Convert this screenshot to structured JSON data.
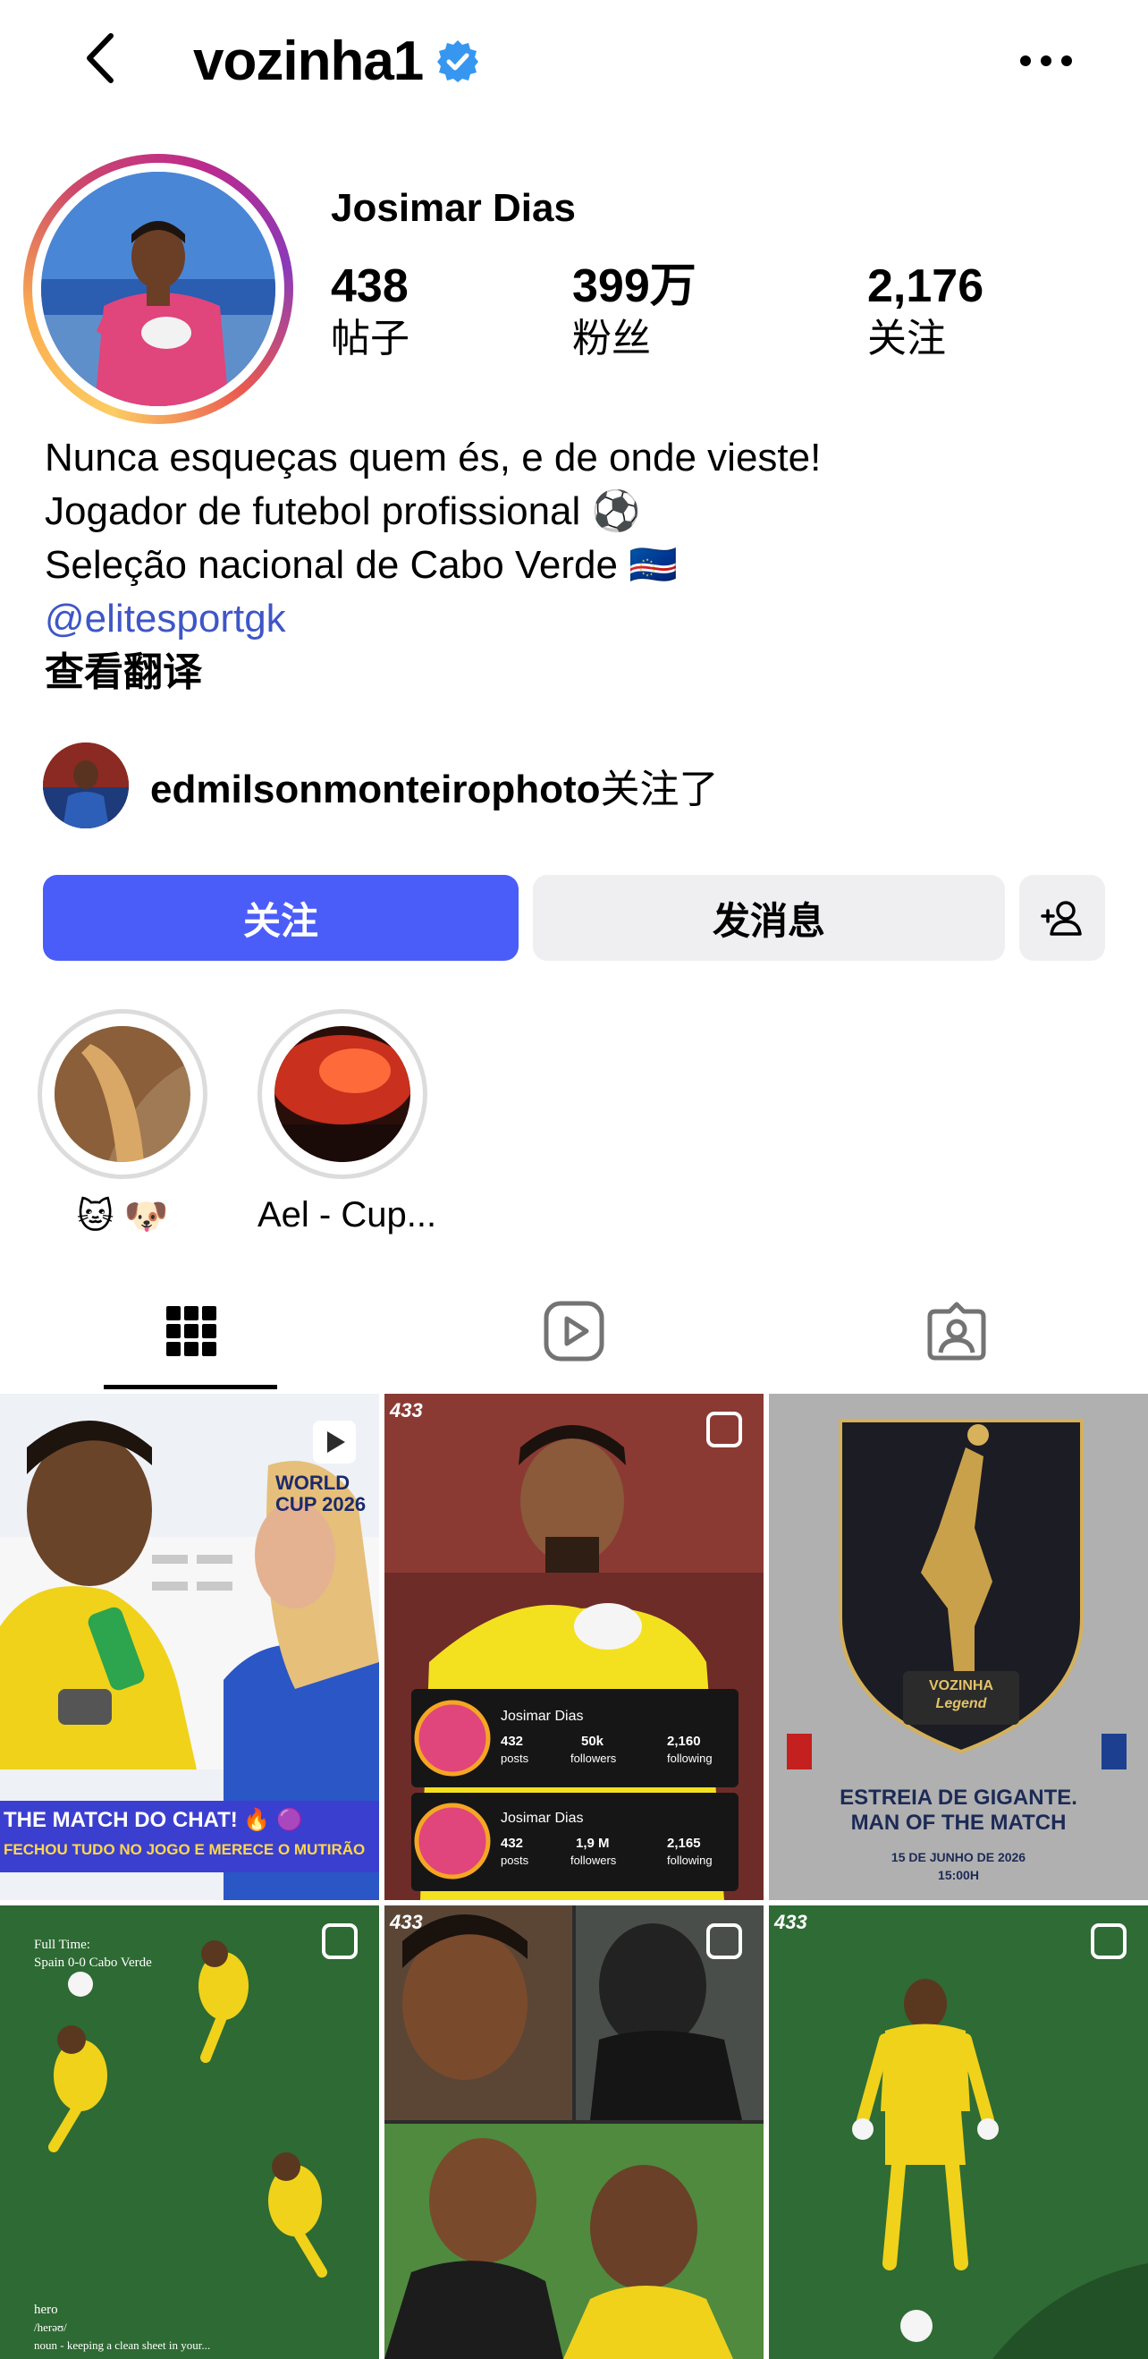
{
  "header": {
    "username": "vozinha1",
    "back_icon": "chevron-left-icon",
    "verified_icon": "verified-badge-icon",
    "more_icon": "more-horizontal-icon"
  },
  "profile": {
    "display_name": "Josimar Dias",
    "stats": [
      {
        "value": "438",
        "label": "帖子"
      },
      {
        "value": "399万",
        "label": "粉丝"
      },
      {
        "value": "2,176",
        "label": "关注"
      }
    ],
    "bio_lines": [
      "Nunca esqueças quem és, e de onde vieste!",
      "Jogador de futebol profissional ⚽",
      "Seleção nacional de Cabo Verde 🇨🇻"
    ],
    "mention": "@elitesportgk",
    "translate": "查看翻译",
    "followed_by_user": "edmilsonmonteirophoto",
    "followed_by_suffix": "关注了"
  },
  "actions": {
    "follow": "关注",
    "message": "发消息",
    "add_user_icon": "person-add-icon"
  },
  "highlights": [
    {
      "label": "🐱 🐶"
    },
    {
      "label": "Ael - Cup..."
    }
  ],
  "tabs": [
    {
      "icon": "grid-icon",
      "active": true
    },
    {
      "icon": "reels-icon",
      "active": false
    },
    {
      "icon": "tagged-icon",
      "active": false
    }
  ],
  "posts": {
    "p1_banner_title": "THE MATCH DO CHAT! 🔥 🟣",
    "p1_banner_sub": "FECHOU TUDO NO JOGO E MERECE O MUTIRÃO",
    "p1_logo": "WORLD CUP 2026",
    "p2_brand": "433",
    "p2_card1": {
      "name": "Josimar Dias",
      "posts": "432",
      "followers": "50k",
      "following": "2,160",
      "posts_lbl": "posts",
      "followers_lbl": "followers",
      "following_lbl": "following"
    },
    "p2_card2": {
      "name": "Josimar Dias",
      "posts": "432",
      "followers": "1,9 M",
      "following": "2,165",
      "posts_lbl": "posts",
      "followers_lbl": "followers",
      "following_lbl": "following"
    },
    "p3_name": "VOZINHA",
    "p3_sub": "Legend",
    "p3_title": "ESTREIA DE GIGANTE.",
    "p3_title2": "MAN OF THE MATCH",
    "p3_date": "15 DE JUNHO DE 2026",
    "p3_time": "15:00H",
    "p4_top": "Full Time:",
    "p4_score": "Spain 0-0 Cabo Verde",
    "p4_word": "hero",
    "p4_phon": "/herəʊ/",
    "p4_def": "noun - keeping a clean sheet in your...",
    "p5_brand": "433",
    "p6_brand": "433"
  },
  "colors": {
    "follow_button": "#4a5df9",
    "mention": "#3f56c7",
    "secondary_button": "#efeff1"
  }
}
